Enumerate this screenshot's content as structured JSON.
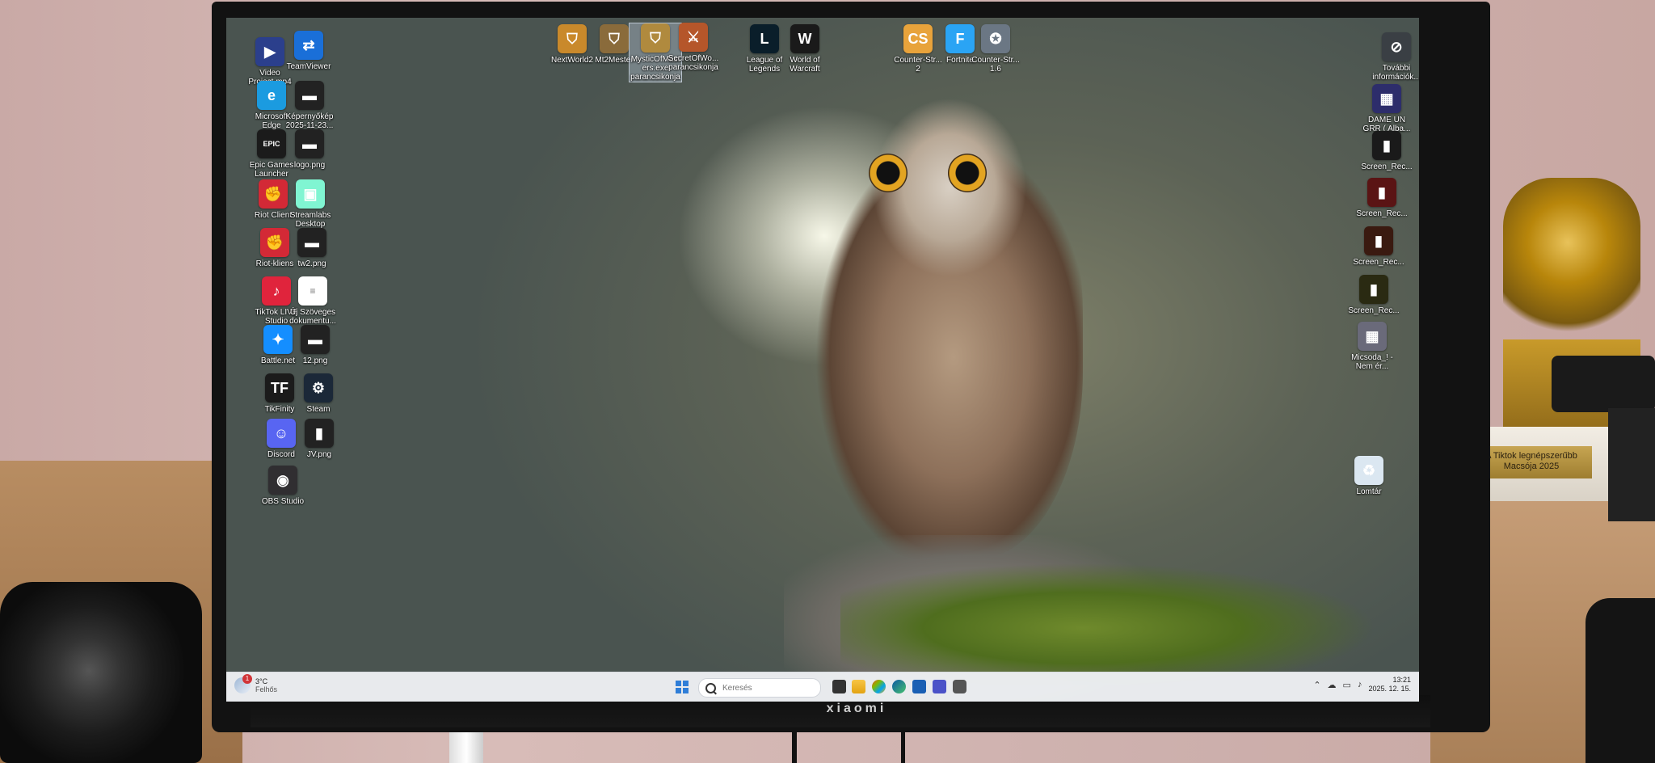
{
  "monitor": {
    "brand": "xiaomi"
  },
  "trophy": {
    "plaque_line1": "A Tiktok legnépszerűbb",
    "plaque_line2": "Macsója 2025"
  },
  "desktop": {
    "left_column": [
      {
        "name": "video-project-icon",
        "label": "Video Project.mp4",
        "glyph": "▶",
        "color": "#2b3f8c"
      },
      {
        "name": "teamviewer-icon",
        "label": "TeamViewer",
        "glyph": "⇄",
        "color": "#1a6fd8"
      },
      {
        "name": "microsoft-edge-icon",
        "label": "Microsoft Edge",
        "glyph": "e",
        "color": "#1b9be0"
      },
      {
        "name": "kepernyokep-icon",
        "label": "Képernyőkép 2025-11-23...",
        "glyph": "▬",
        "color": "#222222"
      },
      {
        "name": "epic-games-icon",
        "label": "Epic Games Launcher",
        "glyph": "EPIC",
        "color": "#1b1b1b"
      },
      {
        "name": "logo-png-icon",
        "label": "logo.png",
        "glyph": "▬",
        "color": "#222222"
      },
      {
        "name": "riot-client-icon",
        "label": "Riot Client",
        "glyph": "✊",
        "color": "#d32936"
      },
      {
        "name": "streamlabs-icon",
        "label": "Streamlabs Desktop",
        "glyph": "▣",
        "color": "#80f5d2"
      },
      {
        "name": "riot-kliens-icon",
        "label": "Riot-kliens",
        "glyph": "✊",
        "color": "#d32936"
      },
      {
        "name": "tw2-png-icon",
        "label": "tw2.png",
        "glyph": "▬",
        "color": "#222222"
      },
      {
        "name": "tiktok-live-icon",
        "label": "TikTok LIVE Studio",
        "glyph": "♪",
        "color": "#e0243c"
      },
      {
        "name": "uj-szoveges-icon",
        "label": "Új Szöveges dokumentu...",
        "glyph": "≡",
        "color": "#ffffff"
      },
      {
        "name": "battlenet-icon",
        "label": "Battle.net",
        "glyph": "✦",
        "color": "#148eff"
      },
      {
        "name": "12-png-icon",
        "label": "12.png",
        "glyph": "▬",
        "color": "#222222"
      },
      {
        "name": "tikfinity-icon",
        "label": "TikFinity",
        "glyph": "TF",
        "color": "#1b1b1b"
      },
      {
        "name": "steam-icon",
        "label": "Steam",
        "glyph": "⚙",
        "color": "#1b2838"
      },
      {
        "name": "discord-icon",
        "label": "Discord",
        "glyph": "☺",
        "color": "#5865f2"
      },
      {
        "name": "jv-png-icon",
        "label": "JV.png",
        "glyph": "▮",
        "color": "#222222"
      },
      {
        "name": "obs-studio-icon",
        "label": "OBS Studio",
        "glyph": "◉",
        "color": "#302e31"
      }
    ],
    "top_row": [
      {
        "name": "nextworld2-icon",
        "label": "NextWorld2",
        "glyph": "⛉",
        "color": "#c9892b"
      },
      {
        "name": "mt2mester-icon",
        "label": "Mt2Mester",
        "glyph": "⛉",
        "color": "#8a6b3b"
      },
      {
        "name": "mysticofmasters-icon",
        "label": "MysticOfMast ers.exe parancsikonja",
        "glyph": "⛉",
        "color": "#b08a3e"
      },
      {
        "name": "secretofwo-icon",
        "label": "SecretOfWo... parancsikonja",
        "glyph": "⚔",
        "color": "#b5562a"
      },
      {
        "name": "league-of-legends-icon",
        "label": "League of Legends",
        "glyph": "L",
        "color": "#0a1e2a"
      },
      {
        "name": "world-of-warcraft-icon",
        "label": "World of Warcraft",
        "glyph": "W",
        "color": "#1a1a1a"
      },
      {
        "name": "counter-strike-2-icon",
        "label": "Counter-Str... 2",
        "glyph": "CS",
        "color": "#e8a33b"
      },
      {
        "name": "fortnite-icon",
        "label": "Fortnite",
        "glyph": "F",
        "color": "#2aa4f4"
      },
      {
        "name": "counter-strike-16-icon",
        "label": "Counter-Str... 1.6",
        "glyph": "✪",
        "color": "#6b7784"
      }
    ],
    "right_column": [
      {
        "name": "tovabbi-informaciok-icon",
        "label": "További információk...",
        "glyph": "⊘",
        "color": "#3a3f44"
      },
      {
        "name": "dame-un-grr-icon",
        "label": "DAME UN GRR ( Alba...",
        "glyph": "▦",
        "color": "#2d2d6b"
      },
      {
        "name": "screen-rec-1-icon",
        "label": "Screen_Rec...",
        "glyph": "▮",
        "color": "#1a1a1a"
      },
      {
        "name": "screen-rec-2-icon",
        "label": "Screen_Rec...",
        "glyph": "▮",
        "color": "#5a1414"
      },
      {
        "name": "screen-rec-3-icon",
        "label": "Screen_Rec...",
        "glyph": "▮",
        "color": "#3a1a10"
      },
      {
        "name": "screen-rec-4-icon",
        "label": "Screen_Rec...",
        "glyph": "▮",
        "color": "#2a2a12"
      },
      {
        "name": "micsoda-icon",
        "label": "Micsoda_! -Nem ér...",
        "glyph": "▦",
        "color": "#6a6a7a"
      },
      {
        "name": "lomtar-icon",
        "label": "Lomtár",
        "glyph": "♻",
        "color": "#dbe7f1"
      }
    ]
  },
  "taskbar": {
    "weather": {
      "temp": "3°C",
      "condition": "Felhős",
      "badge": "1"
    },
    "search": {
      "placeholder": "Keresés"
    },
    "clock": {
      "time": "13:21",
      "date": "2025. 12. 15."
    }
  }
}
